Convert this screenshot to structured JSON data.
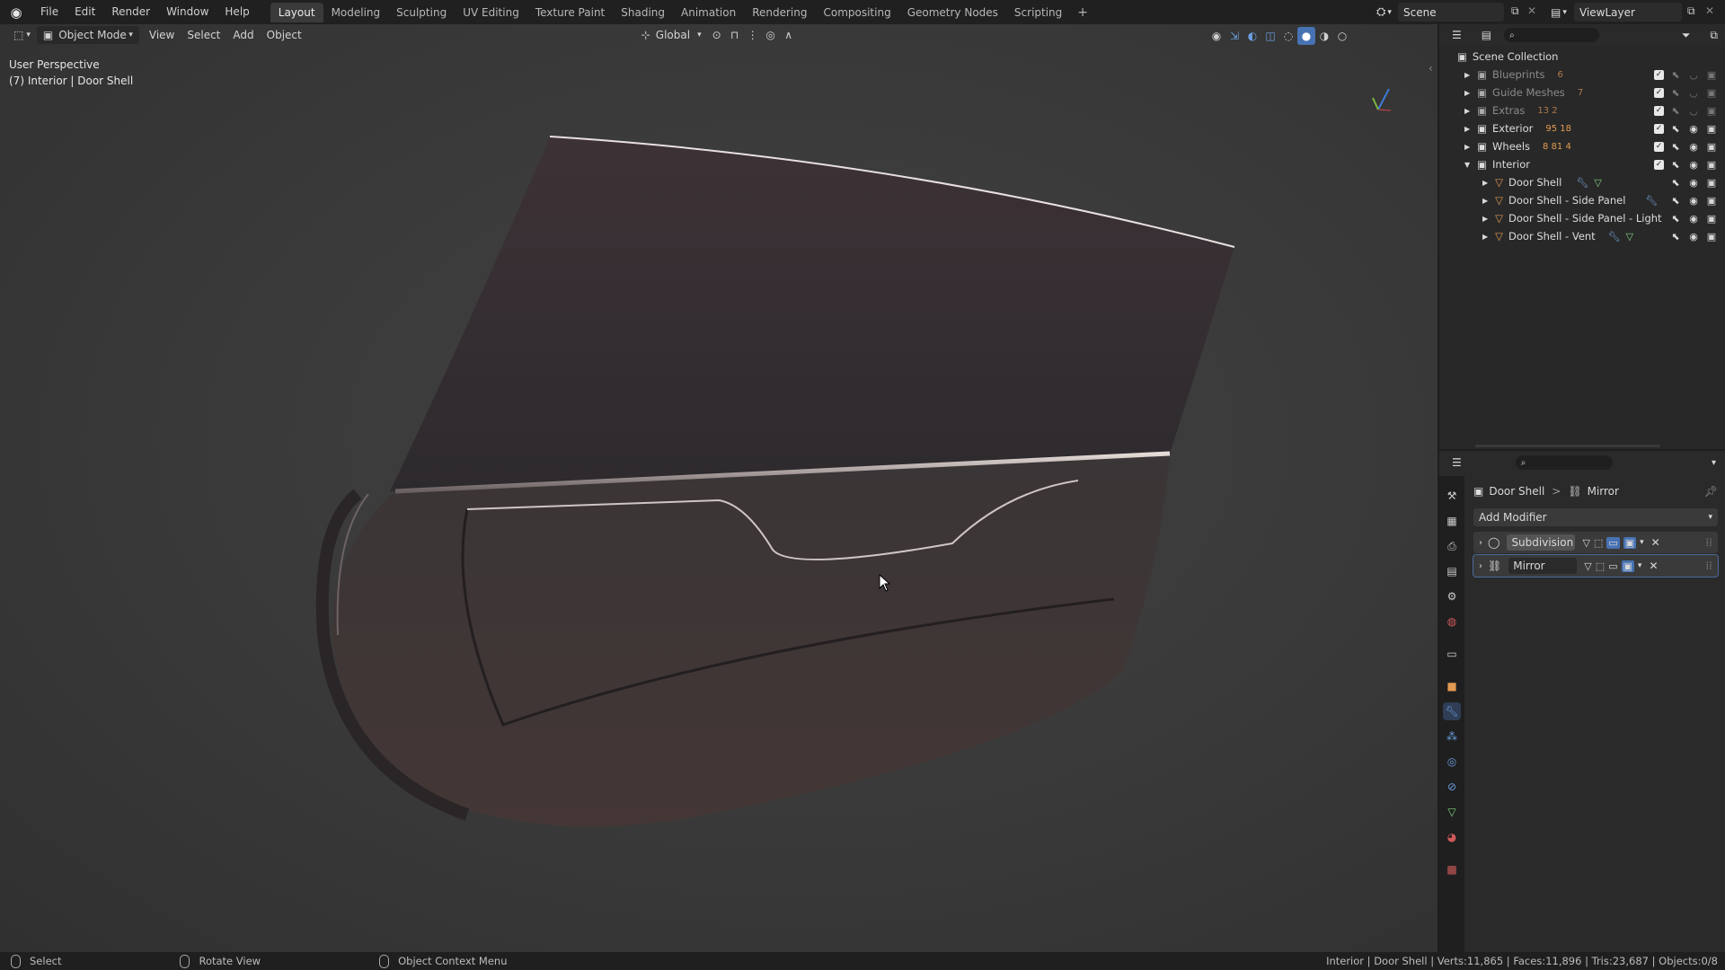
{
  "menu": {
    "items": [
      "File",
      "Edit",
      "Render",
      "Window",
      "Help"
    ]
  },
  "workspaces": [
    "Layout",
    "Modeling",
    "Sculpting",
    "UV Editing",
    "Texture Paint",
    "Shading",
    "Animation",
    "Rendering",
    "Compositing",
    "Geometry Nodes",
    "Scripting"
  ],
  "workspace_add": "+",
  "scene": {
    "name": "Scene"
  },
  "viewlayer": {
    "name": "ViewLayer"
  },
  "viewport": {
    "mode": "Object Mode",
    "menus": [
      "View",
      "Select",
      "Add",
      "Object"
    ],
    "transform": "Global",
    "info_line1": "User Perspective",
    "info_line2": "(7) Interior | Door Shell"
  },
  "outliner": {
    "root": "Scene Collection",
    "rows": [
      {
        "name": "Blueprints",
        "badge": "6",
        "dim": true
      },
      {
        "name": "Guide Meshes",
        "badge": "7",
        "dim": true
      },
      {
        "name": "Extras",
        "badge": "13 2",
        "dim": true
      },
      {
        "name": "Exterior",
        "badge": "95 18",
        "dim": false
      },
      {
        "name": "Wheels",
        "badge": "8 81 4",
        "dim": false
      },
      {
        "name": "Interior",
        "badge": "",
        "dim": false
      },
      {
        "name": "Door Shell",
        "badge": "",
        "dim": false
      },
      {
        "name": "Door Shell - Side Panel",
        "badge": "",
        "dim": false
      },
      {
        "name": "Door Shell - Side Panel - Light",
        "badge": "",
        "dim": false
      },
      {
        "name": "Door Shell - Vent",
        "badge": "",
        "dim": false
      }
    ]
  },
  "properties": {
    "breadcrumb_object": "Door Shell",
    "breadcrumb_sep": ">",
    "breadcrumb_modifier": "Mirror",
    "add_modifier": "Add Modifier",
    "modifiers": [
      {
        "name": "Subdivision"
      },
      {
        "name": "Mirror"
      }
    ]
  },
  "statusbar": {
    "select": "Select",
    "rotate": "Rotate View",
    "context": "Object Context Menu",
    "stats": "Interior | Door Shell | Verts:11,865 | Faces:11,896 | Tris:23,687 | Objects:0/8"
  },
  "colors": {
    "accent": "#4772b3",
    "object_orange": "#e39a52",
    "mesh_green": "#7fd17f"
  }
}
